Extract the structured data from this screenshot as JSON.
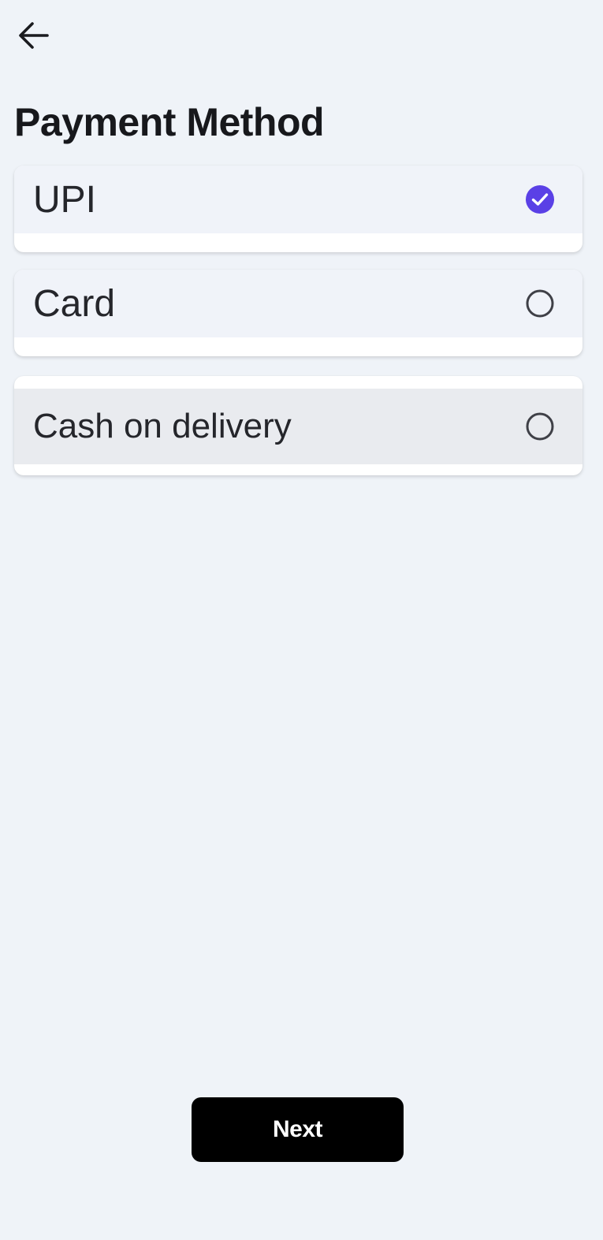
{
  "header": {
    "back_icon": "arrow-left-icon",
    "title": "Payment Method"
  },
  "payment_options": [
    {
      "label": "UPI",
      "selected": true,
      "icon": "checked-circle-icon"
    },
    {
      "label": "Card",
      "selected": false,
      "icon": "empty-circle-icon"
    },
    {
      "label": "Cash on delivery",
      "selected": false,
      "icon": "empty-circle-icon"
    }
  ],
  "footer": {
    "next_label": "Next"
  },
  "colors": {
    "background": "#eff3f8",
    "accent": "#5a40e6",
    "button": "#000000",
    "button_text": "#ffffff"
  }
}
